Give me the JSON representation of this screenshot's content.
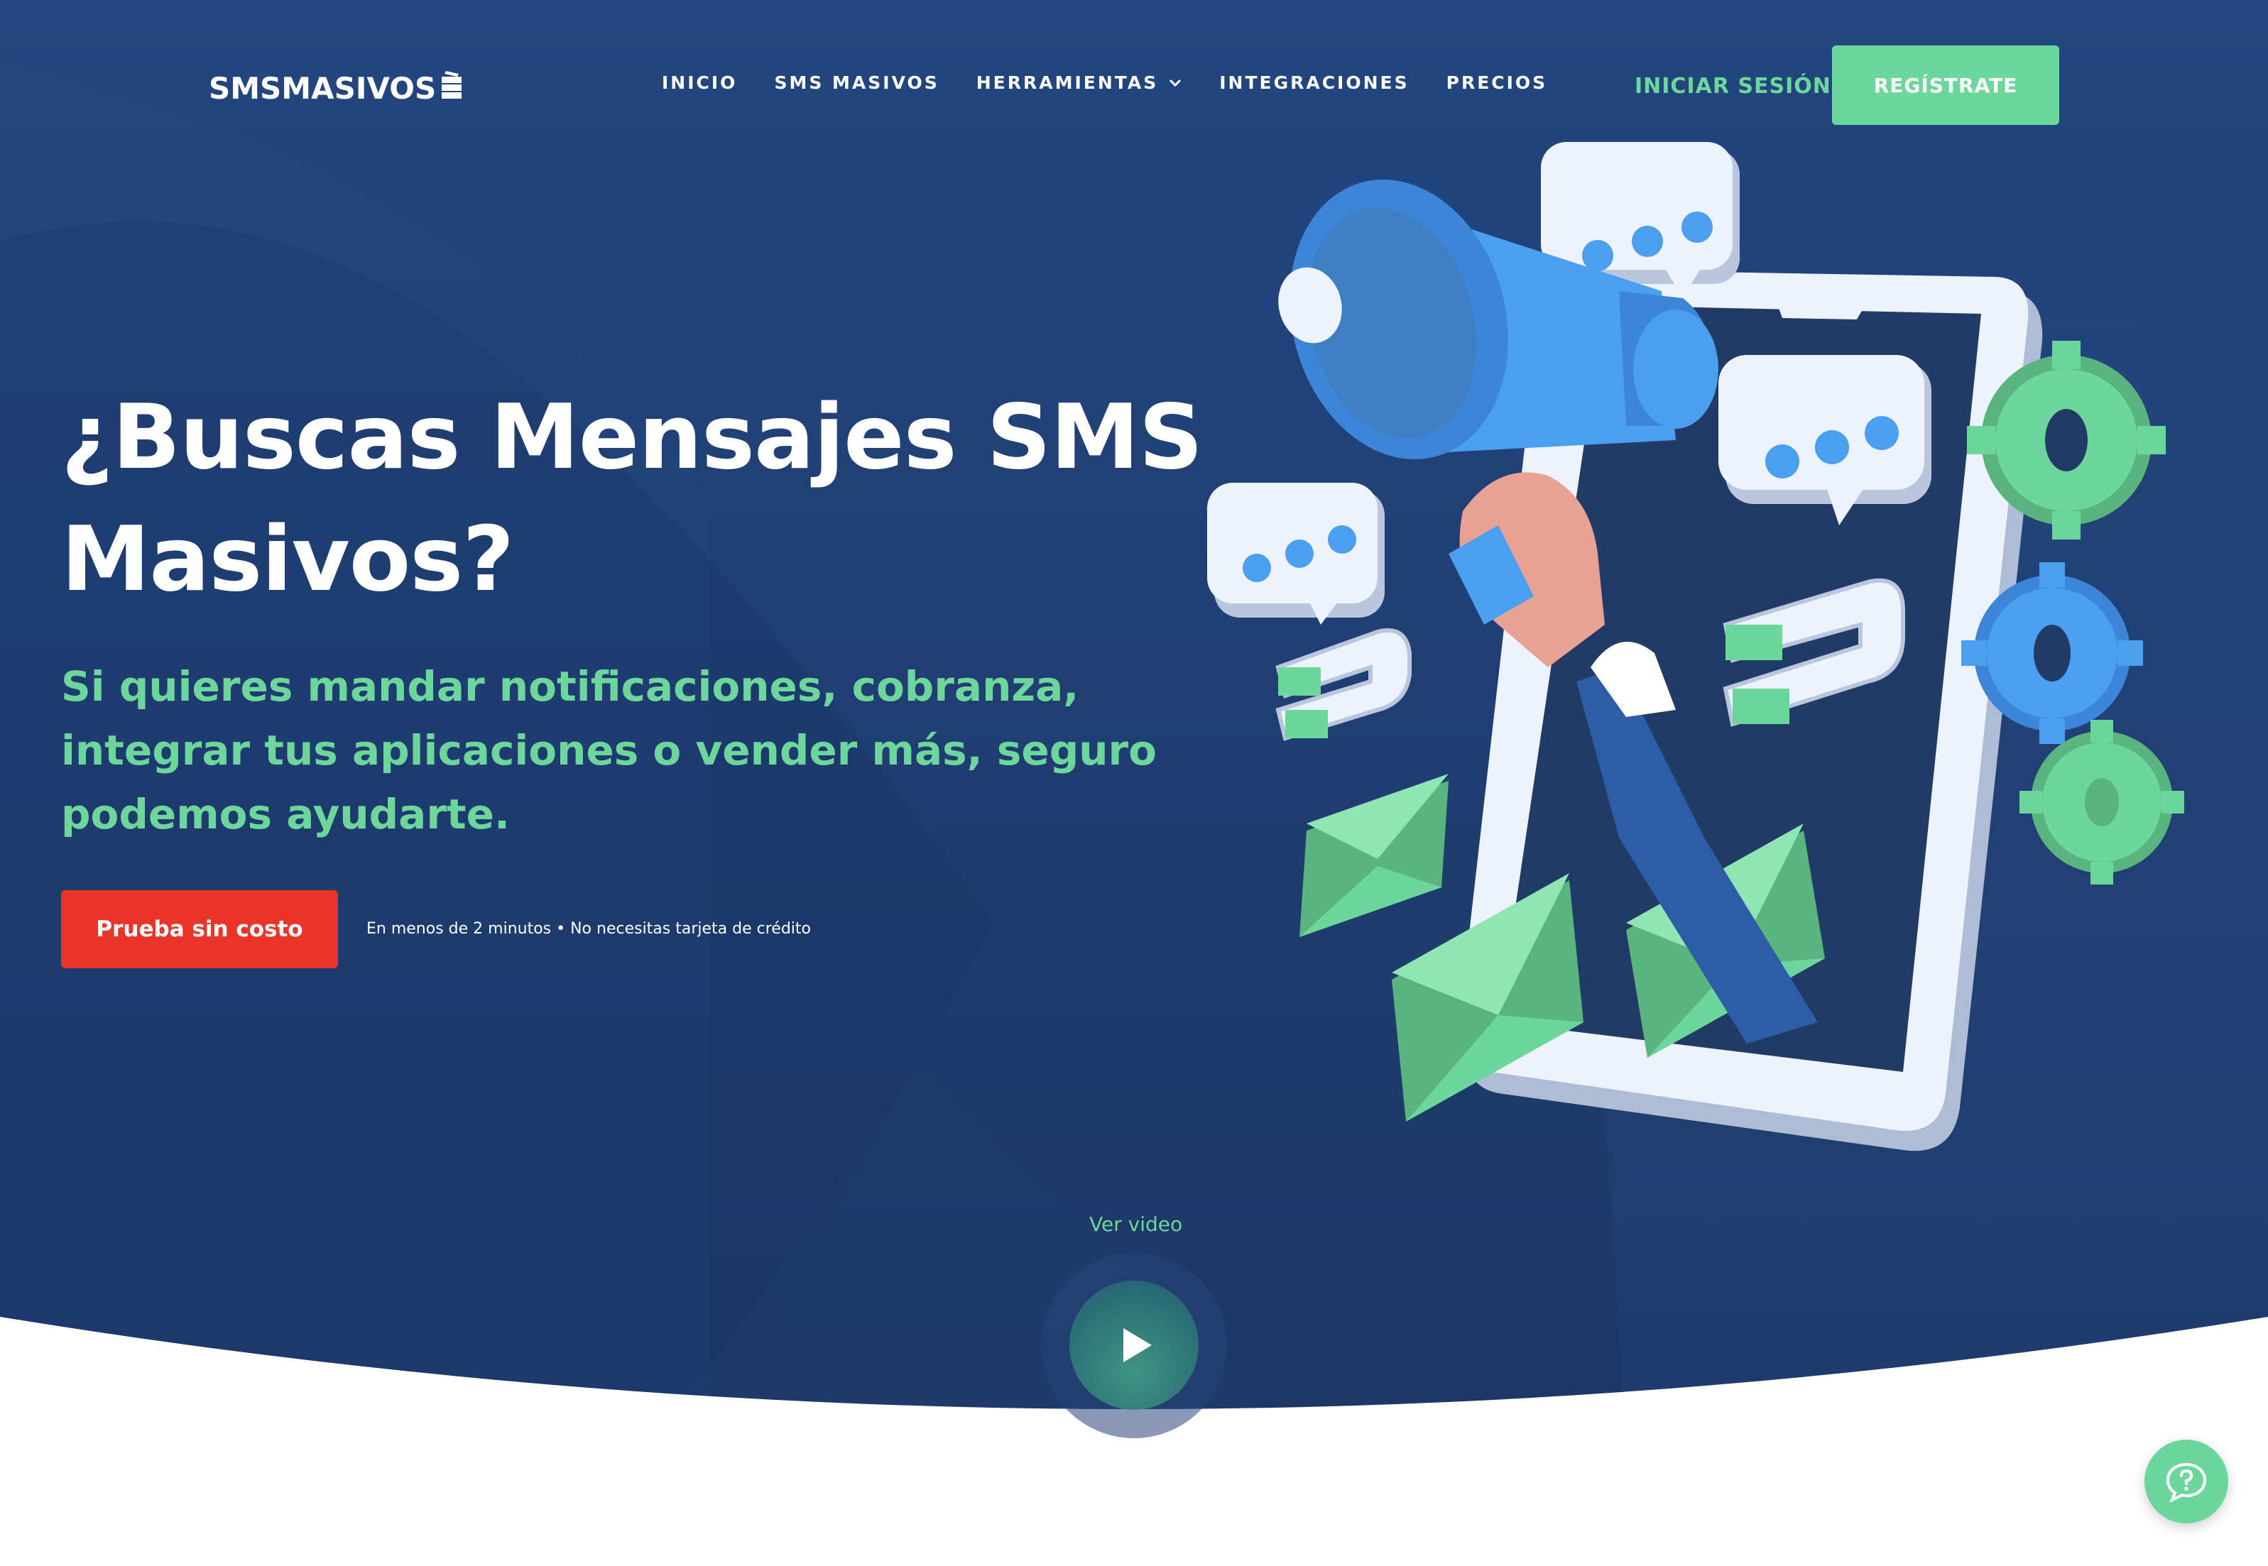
{
  "brand": {
    "name": "SMSMASIVOS"
  },
  "nav": {
    "items": [
      {
        "label": "INICIO"
      },
      {
        "label": "SMS MASIVOS"
      },
      {
        "label": "HERRAMIENTAS",
        "has_dropdown": true
      },
      {
        "label": "INTEGRACIONES"
      },
      {
        "label": "PRECIOS"
      }
    ],
    "login_label": "INICIAR SESIÓN",
    "signup_label": "REGÍSTRATE"
  },
  "hero": {
    "headline": "¿Buscas Mensajes SMS Masivos?",
    "subheadline": "Si quieres mandar notificaciones, cobranza, integrar tus aplicaciones o vender más, seguro podemos ayudarte.",
    "cta_label": "Prueba sin costo",
    "cta_note": "En menos de 2 minutos • No necesitas tarjeta de crédito"
  },
  "video": {
    "label": "Ver video"
  },
  "icons": {
    "logo": "stacked-boxes-icon",
    "dropdown": "chevron-down-icon",
    "play": "play-icon",
    "help": "help-chat-icon",
    "illustration": "megaphone-phone-illustration"
  },
  "colors": {
    "background": "#1f3d6e",
    "accent_green": "#6dd79b",
    "cta_red": "#e9342a",
    "text": "#ffffff"
  }
}
